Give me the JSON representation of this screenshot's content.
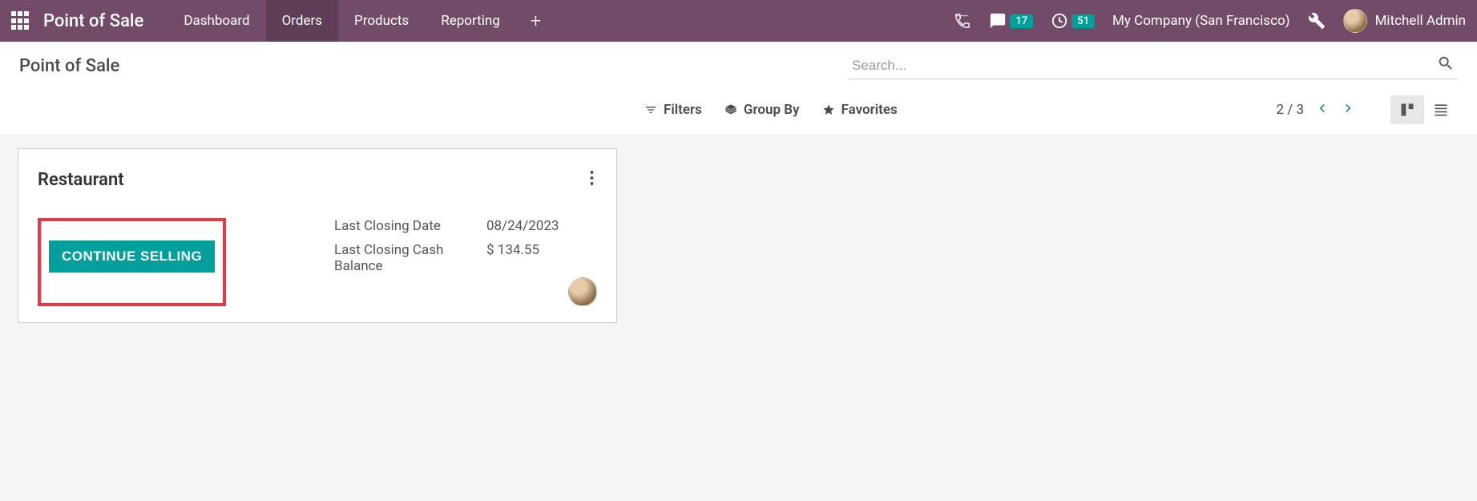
{
  "topbar": {
    "app_title": "Point of Sale",
    "nav": [
      {
        "label": "Dashboard",
        "active": false
      },
      {
        "label": "Orders",
        "active": true
      },
      {
        "label": "Products",
        "active": false
      },
      {
        "label": "Reporting",
        "active": false
      }
    ],
    "messages_badge": "17",
    "activities_badge": "51",
    "company_name": "My Company (San Francisco)",
    "user_name": "Mitchell Admin"
  },
  "controlbar": {
    "page_title": "Point of Sale",
    "search_placeholder": "Search...",
    "filters_label": "Filters",
    "groupby_label": "Group By",
    "favorites_label": "Favorites",
    "pager_text": "2 / 3"
  },
  "card": {
    "title": "Restaurant",
    "button_label": "CONTINUE SELLING",
    "fields": {
      "last_closing_date_label": "Last Closing Date",
      "last_closing_date_value": "08/24/2023",
      "last_closing_balance_label": "Last Closing Cash Balance",
      "last_closing_balance_value": "$ 134.55"
    }
  }
}
